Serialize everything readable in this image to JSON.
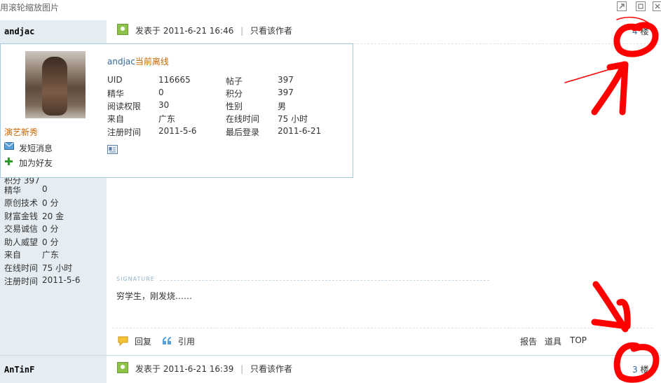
{
  "window": {
    "title": "用滚轮缩放图片"
  },
  "post1": {
    "username": "andjac",
    "posted_prefix": "发表于",
    "posted_time": "2011-6-21 16:46",
    "only_author": "只看该作者",
    "floor_num": "4",
    "floor_suffix": "楼",
    "signature_label": "SIGNATURE",
    "signature_text": "穷学生，刚发烧……",
    "actions": {
      "reply": "回复",
      "quote": "引用",
      "report": "报告",
      "tools": "道具",
      "top": "TOP"
    }
  },
  "popup": {
    "username": "andjac",
    "status": "当前离线",
    "stats": [
      {
        "label": "UID",
        "value": "116665",
        "label2": "帖子",
        "value2": "397"
      },
      {
        "label": "精华",
        "value": "0",
        "label2": "积分",
        "value2": "397"
      },
      {
        "label": "阅读权限",
        "value": "30",
        "label2": "性别",
        "value2": "男"
      },
      {
        "label": "来自",
        "value": "广东",
        "label2": "在线时间",
        "value2": "75 小时"
      },
      {
        "label": "注册时间",
        "value": "2011-5-6",
        "label2": "最后登录",
        "value2": "2011-6-21"
      }
    ]
  },
  "sidebar": {
    "rank": "演艺新秀",
    "send_msg": "发短消息",
    "add_friend": "加为好友",
    "partial_row": "积分  397",
    "rows": [
      {
        "label": "精华",
        "value": "0"
      },
      {
        "label": "原创技术",
        "value": "0 分"
      },
      {
        "label": "财富金钱",
        "value": "20 金"
      },
      {
        "label": "交易诚信",
        "value": "0 分"
      },
      {
        "label": "助人威望",
        "value": "0 分"
      },
      {
        "label": "来自",
        "value": "广东"
      },
      {
        "label": "在线时间",
        "value": "75 小时"
      },
      {
        "label": "注册时间",
        "value": "2011-5-6"
      }
    ]
  },
  "post2": {
    "username": "AnTinF",
    "posted_prefix": "发表于",
    "posted_time": "2011-6-21 16:39",
    "only_author": "只看该作者",
    "floor_num": "3",
    "floor_suffix": "楼"
  },
  "colors": {
    "annotation_red": "#ff0000",
    "link_blue": "#336699",
    "rank_orange": "#cc6600",
    "sidebar_bg": "#e5edf2"
  }
}
